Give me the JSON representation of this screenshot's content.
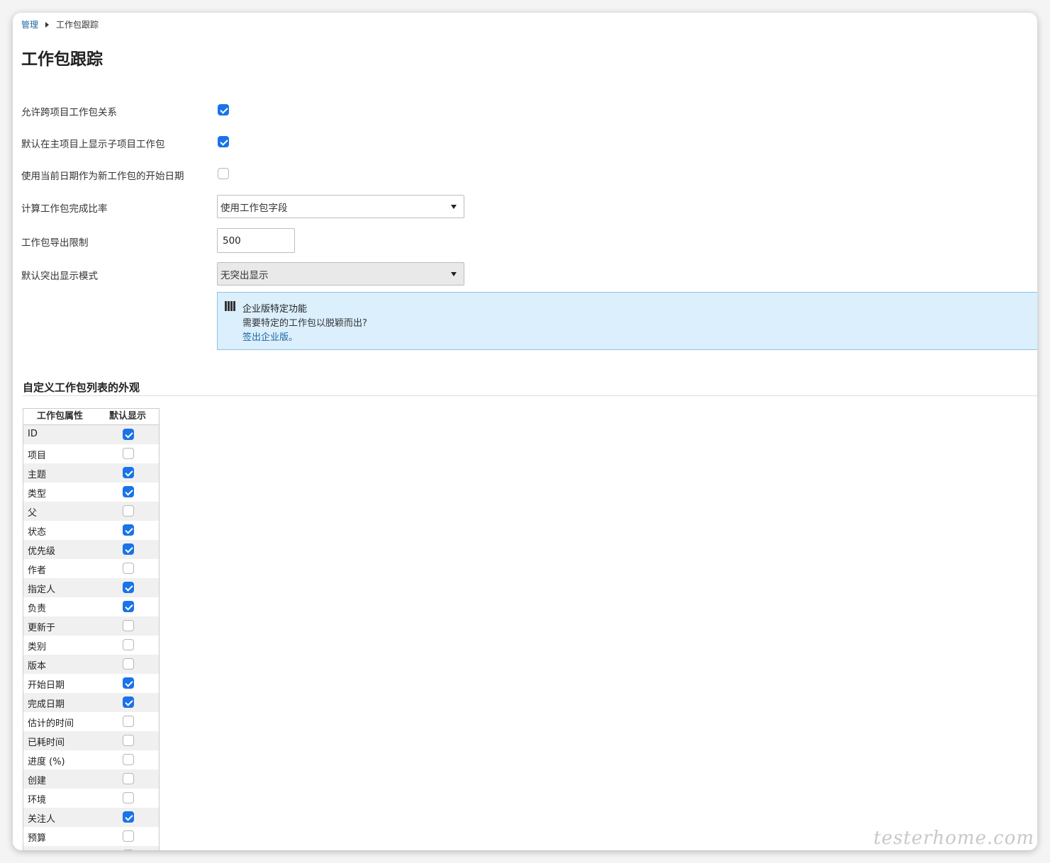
{
  "breadcrumb": {
    "root": "管理",
    "current": "工作包跟踪"
  },
  "title": "工作包跟踪",
  "settings": {
    "cross_project": {
      "label": "允许跨项目工作包关系",
      "checked": true
    },
    "show_subprojects": {
      "label": "默认在主项目上显示子项目工作包",
      "checked": true
    },
    "current_date_start": {
      "label": "使用当前日期作为新工作包的开始日期",
      "checked": false
    },
    "done_ratio": {
      "label": "计算工作包完成比率",
      "value": "使用工作包字段"
    },
    "export_limit": {
      "label": "工作包导出限制",
      "value": "500"
    },
    "highlight_mode": {
      "label": "默认突出显示模式",
      "value": "无突出显示"
    }
  },
  "enterprise_notice": {
    "icon": "enterprise-icon",
    "title": "企业版特定功能",
    "description": "需要特定的工作包以脱颖而出?",
    "link": "签出企业版。"
  },
  "section": {
    "title": "自定义工作包列表的外观"
  },
  "attributes_table": {
    "headers": [
      "工作包属性",
      "默认显示"
    ],
    "rows": [
      {
        "name": "ID",
        "checked": true
      },
      {
        "name": "项目",
        "checked": false
      },
      {
        "name": "主题",
        "checked": true
      },
      {
        "name": "类型",
        "checked": true
      },
      {
        "name": "父",
        "checked": false
      },
      {
        "name": "状态",
        "checked": true
      },
      {
        "name": "优先级",
        "checked": true
      },
      {
        "name": "作者",
        "checked": false
      },
      {
        "name": "指定人",
        "checked": true
      },
      {
        "name": "负责",
        "checked": true
      },
      {
        "name": "更新于",
        "checked": false
      },
      {
        "name": "类别",
        "checked": false
      },
      {
        "name": "版本",
        "checked": false
      },
      {
        "name": "开始日期",
        "checked": true
      },
      {
        "name": "完成日期",
        "checked": true
      },
      {
        "name": "估计的时间",
        "checked": false
      },
      {
        "name": "已耗时间",
        "checked": false
      },
      {
        "name": "进度 (%)",
        "checked": false
      },
      {
        "name": "创建",
        "checked": false
      },
      {
        "name": "环境",
        "checked": false
      },
      {
        "name": "关注人",
        "checked": true
      },
      {
        "name": "预算",
        "checked": false
      },
      {
        "name": "",
        "checked": false
      }
    ]
  },
  "watermark": "testerhome.com",
  "colors": {
    "accent": "#1a73e8",
    "link": "#1a67a3",
    "notice_bg": "#dbeffd"
  }
}
